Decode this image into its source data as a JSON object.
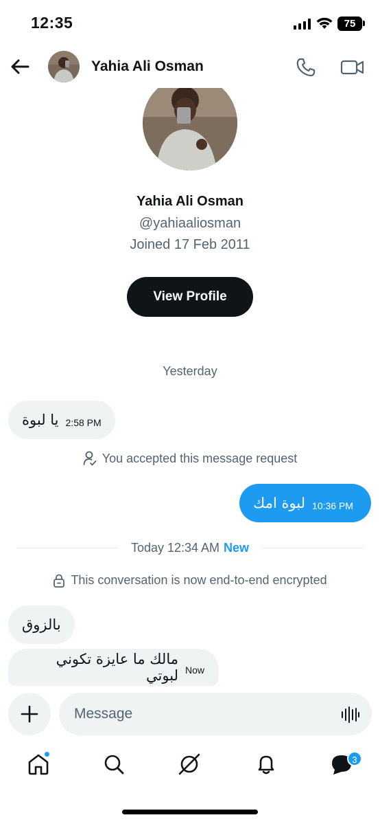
{
  "status_bar": {
    "time": "12:35",
    "battery": "75"
  },
  "header": {
    "contact_name": "Yahia Ali Osman"
  },
  "profile": {
    "name": "Yahia Ali Osman",
    "handle": "@yahiaaliosman",
    "joined": "Joined 17 Feb 2011",
    "view_profile_label": "View Profile"
  },
  "conversation": {
    "day1_label": "Yesterday",
    "msg1": {
      "text": "يا لبوة",
      "time": "2:58 PM",
      "direction": "incoming"
    },
    "accepted_note": "You accepted this message request",
    "msg2": {
      "text": "لبوة امك",
      "time": "10:36 PM",
      "direction": "outgoing"
    },
    "day2_label": "Today 12:34 AM",
    "new_label": "New",
    "encrypted_note": "This conversation is now end-to-end encrypted",
    "msg3": {
      "text": "بالزوق",
      "direction": "incoming"
    },
    "msg4": {
      "text": "مالك ما عايزة تكوني لبوتي",
      "time": "Now",
      "direction": "incoming"
    }
  },
  "composer": {
    "placeholder": "Message"
  },
  "tab_bar": {
    "messages_badge": "3"
  },
  "colors": {
    "accent": "#1d9bf0",
    "text": "#0f1419",
    "muted": "#536471",
    "bubble_in": "#eff3f4"
  }
}
